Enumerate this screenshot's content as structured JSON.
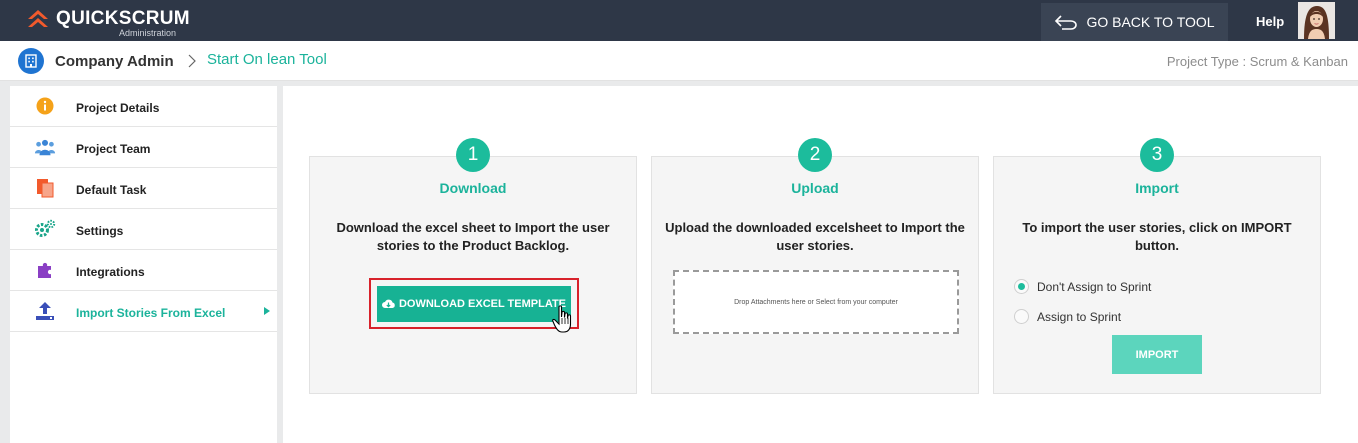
{
  "header": {
    "logo_text": "QUICKSCRUM",
    "logo_subtitle": "Administration",
    "go_back_label": "GO BACK TO TOOL",
    "help_label": "Help"
  },
  "breadcrumb": {
    "company": "Company Admin",
    "current": "Start On lean Tool",
    "project_type": "Project Type : Scrum & Kanban"
  },
  "sidebar": {
    "items": [
      {
        "label": "Project Details",
        "icon": "info-icon"
      },
      {
        "label": "Project Team",
        "icon": "team-icon"
      },
      {
        "label": "Default Task",
        "icon": "document-icon"
      },
      {
        "label": "Settings",
        "icon": "gear-icon"
      },
      {
        "label": "Integrations",
        "icon": "puzzle-icon"
      },
      {
        "label": "Import Stories From Excel",
        "icon": "upload-icon",
        "active": true
      }
    ]
  },
  "steps": [
    {
      "number": "1",
      "title": "Download",
      "description": "Download the excel sheet to Import the user stories to the Product Backlog.",
      "button_label": "DOWNLOAD EXCEL TEMPLATE"
    },
    {
      "number": "2",
      "title": "Upload",
      "description": "Upload the downloaded excelsheet to Import the user stories.",
      "dropzone_text": "Drop Attachments here or Select from your computer"
    },
    {
      "number": "3",
      "title": "Import",
      "description": "To import the user stories, click on IMPORT button.",
      "options": [
        {
          "label": "Don't Assign to Sprint",
          "checked": true
        },
        {
          "label": "Assign to Sprint",
          "checked": false
        }
      ],
      "button_label": "IMPORT"
    }
  ],
  "colors": {
    "topbar": "#2e3747",
    "accent": "#1bb39b",
    "highlight": "#d8222b",
    "import_button": "#5cd5bd"
  }
}
